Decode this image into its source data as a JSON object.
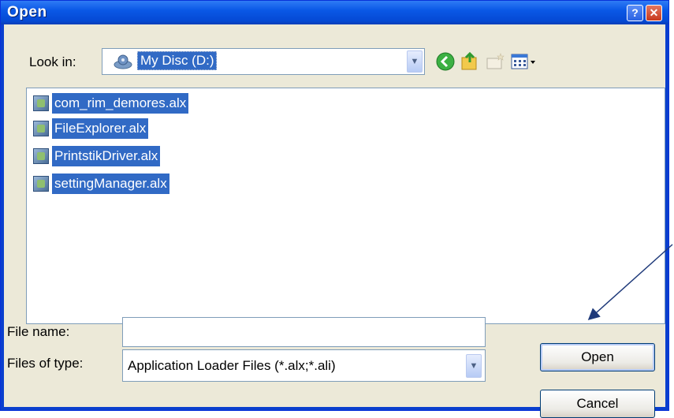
{
  "dialog": {
    "title": "Open",
    "help_glyph": "?",
    "close_glyph": "✕"
  },
  "look_in": {
    "label": "Look in:",
    "value": "My Disc (D:)"
  },
  "toolbar": {
    "icons": [
      "back-icon",
      "up-folder-icon",
      "new-folder-icon",
      "views-menu-icon"
    ]
  },
  "files": [
    {
      "name": "com_rim_demores.alx"
    },
    {
      "name": "FileExplorer.alx"
    },
    {
      "name": "PrintstikDriver.alx"
    },
    {
      "name": "settingManager.alx"
    }
  ],
  "file_name": {
    "label": "File name:",
    "value": ""
  },
  "files_of_type": {
    "label": "Files of type:",
    "value": "Application Loader Files (*.alx;*.ali)"
  },
  "buttons": {
    "open": "Open",
    "cancel": "Cancel"
  },
  "colors": {
    "titlebar": "#0a58e6",
    "selection": "#316ac5",
    "dialog_bg": "#ece9d8",
    "annotation_arrow": "#1f3a7a"
  }
}
